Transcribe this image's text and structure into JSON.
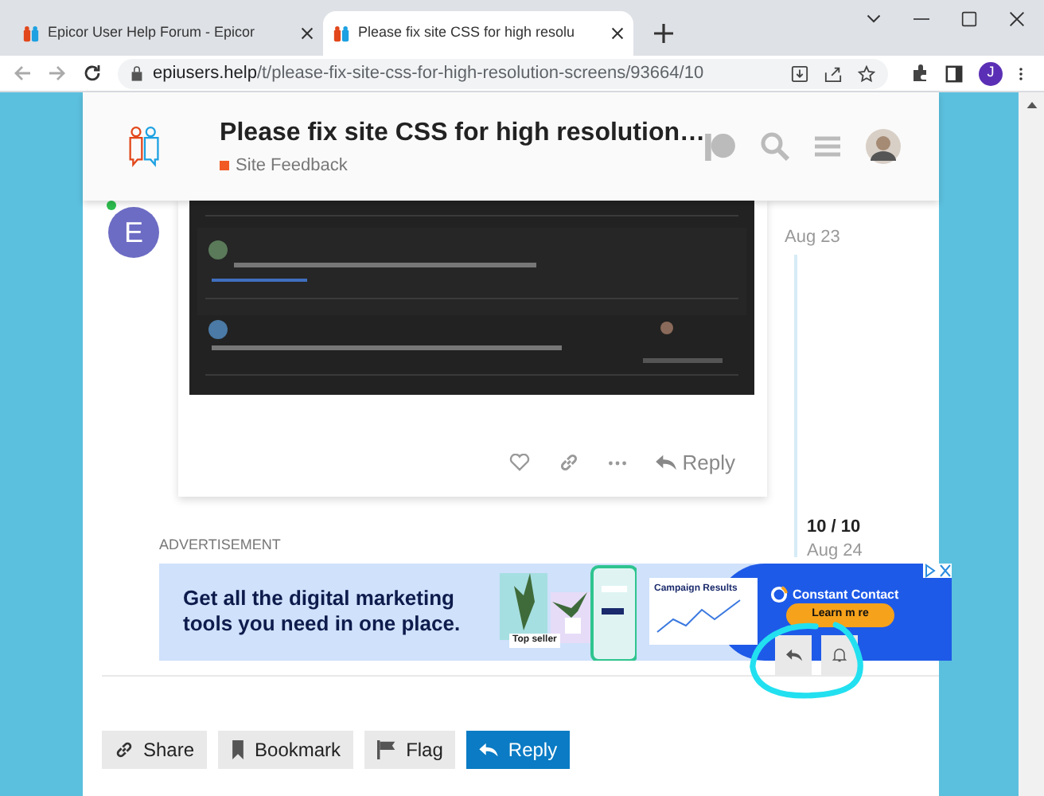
{
  "browser": {
    "tabs": [
      {
        "label": "Epicor User Help Forum - Epicor",
        "selected": false
      },
      {
        "label": "Please fix site CSS for high resolu",
        "selected": true
      }
    ],
    "url": {
      "host": "epiusers.help",
      "path": "/t/please-fix-site-css-for-high-resolution-screens/93664/10"
    },
    "profile": "J"
  },
  "header": {
    "title": "Please fix site CSS for high resolution…",
    "category": {
      "label": "Site Feedback",
      "color": "#f15a24"
    }
  },
  "post": {
    "avatar_letter": "E",
    "actions": {
      "reply": "Reply"
    }
  },
  "timeline": {
    "top_date": "Aug 23",
    "position": "10 / 10",
    "bottom_date": "Aug 24"
  },
  "advertisement": {
    "label": "ADVERTISEMENT",
    "headline": "Get all the digital marketing tools you need in one place.",
    "tag": "Top seller",
    "card_title": "Campaign Results",
    "brand": "Constant Contact",
    "cta": "Learn m re"
  },
  "footer_buttons": [
    {
      "label": "Share",
      "kind": "share",
      "primary": false
    },
    {
      "label": "Bookmark",
      "kind": "bookmark",
      "primary": false
    },
    {
      "label": "Flag",
      "kind": "flag",
      "primary": false
    },
    {
      "label": "Reply",
      "kind": "reply",
      "primary": true
    }
  ]
}
